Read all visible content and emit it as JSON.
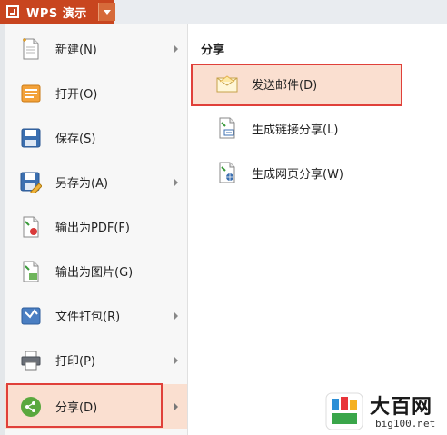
{
  "app": {
    "title": "WPS 演示",
    "brand_color": "#c8451f"
  },
  "menu": {
    "items": [
      {
        "label": "新建(N)",
        "icon": "new-doc-icon",
        "has_submenu": true
      },
      {
        "label": "打开(O)",
        "icon": "open-folder-icon",
        "has_submenu": false
      },
      {
        "label": "保存(S)",
        "icon": "save-disk-icon",
        "has_submenu": false
      },
      {
        "label": "另存为(A)",
        "icon": "save-as-icon",
        "has_submenu": true
      },
      {
        "label": "输出为PDF(F)",
        "icon": "export-pdf-icon",
        "has_submenu": false
      },
      {
        "label": "输出为图片(G)",
        "icon": "export-image-icon",
        "has_submenu": false
      },
      {
        "label": "文件打包(R)",
        "icon": "file-package-icon",
        "has_submenu": true
      },
      {
        "label": "打印(P)",
        "icon": "printer-icon",
        "has_submenu": true
      },
      {
        "label": "分享(D)",
        "icon": "share-icon",
        "has_submenu": true,
        "selected": true
      }
    ]
  },
  "submenu": {
    "title": "分享",
    "items": [
      {
        "label": "发送邮件(D)",
        "icon": "email-envelope-icon",
        "active": true
      },
      {
        "label": "生成链接分享(L)",
        "icon": "link-share-icon"
      },
      {
        "label": "生成网页分享(W)",
        "icon": "web-share-icon"
      }
    ]
  },
  "watermark": {
    "title": "大百网",
    "url": "big100.net"
  },
  "colors": {
    "highlight_border": "#e0403a",
    "selected_bg": "#fadfd0"
  }
}
